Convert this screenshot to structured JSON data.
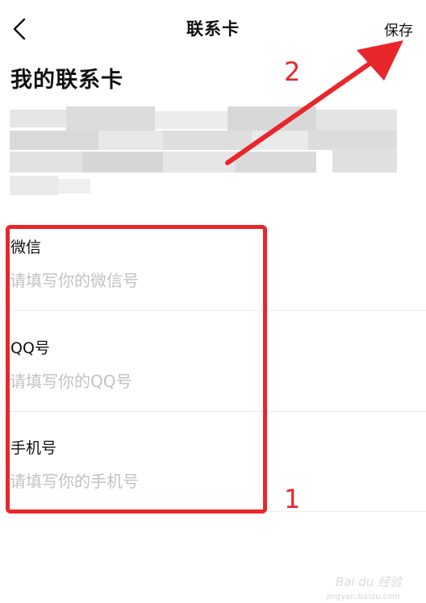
{
  "nav": {
    "title": "联系卡",
    "save_label": "保存"
  },
  "page": {
    "title": "我的联系卡"
  },
  "fields": [
    {
      "label": "微信",
      "placeholder": "请填写你的微信号",
      "value": ""
    },
    {
      "label": "QQ号",
      "placeholder": "请填写你的QQ号",
      "value": ""
    },
    {
      "label": "手机号",
      "placeholder": "请填写你的手机号",
      "value": ""
    }
  ],
  "annotations": {
    "box_number": "1",
    "arrow_number": "2",
    "color": "#e8262b"
  },
  "watermark": {
    "text": "Bai du 经验",
    "sub": "jingyan.baidu.com"
  },
  "icons": {
    "back": "chevron-left-icon"
  }
}
